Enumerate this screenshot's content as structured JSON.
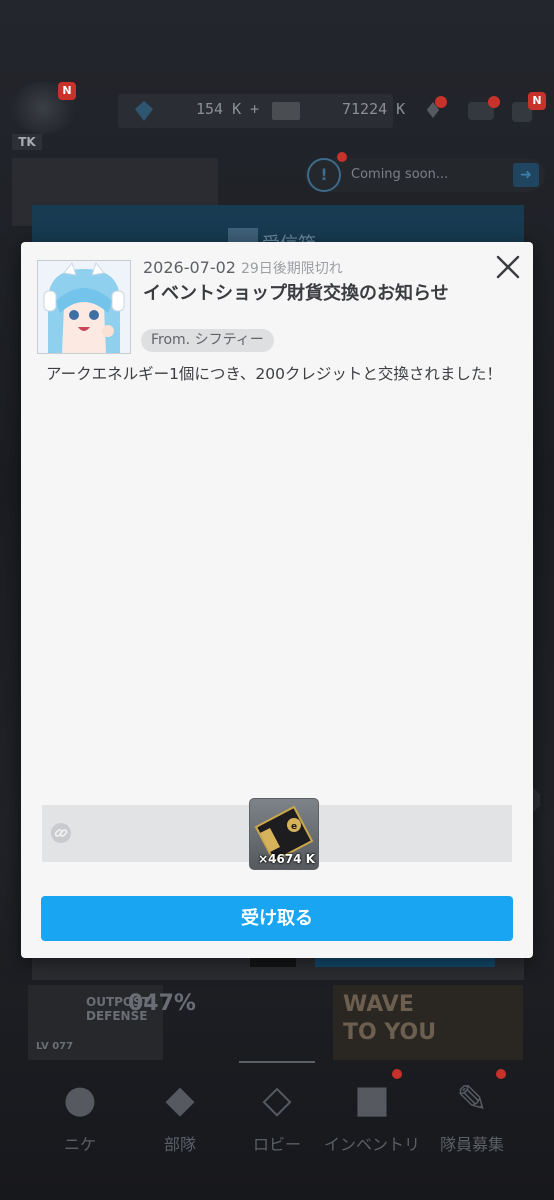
{
  "topbar": {
    "resource1": "154 K +",
    "resource2": "71224 K",
    "badge": "N",
    "tag": "TK"
  },
  "event_bar": {
    "text": "Coming soon..."
  },
  "mailbox": {
    "title_hidden": "受信箱"
  },
  "mail": {
    "date": "2026-07-02",
    "expiry": "29日後期限切れ",
    "title": "イベントショップ財貨交換のお知らせ",
    "from": "From. シフティー",
    "body": "アークエネルギー1個につき、200クレジットと交換されました！",
    "attachment": {
      "icon": "credit-card-icon",
      "count": "×4674 K"
    },
    "receive_label": "受け取る"
  },
  "background_banners": {
    "outpost_line1": "OUTPOST",
    "outpost_line2": "DEFENSE",
    "outpost_percent": "047%",
    "outpost_level": "LV 077",
    "wave_line1": "WAVE",
    "wave_line2": "TO YOU"
  },
  "nav": {
    "items": [
      {
        "label": "ニケ",
        "icon": "nikke-icon"
      },
      {
        "label": "部隊",
        "icon": "squad-icon"
      },
      {
        "label": "ロビー",
        "icon": "lobby-icon"
      },
      {
        "label": "インベントリ",
        "icon": "inventory-icon"
      },
      {
        "label": "隊員募集",
        "icon": "recruit-icon"
      }
    ]
  },
  "colors": {
    "accent": "#1aa5f3",
    "dialog_bg": "#f6f6f6",
    "notification_red": "#c7322a"
  }
}
